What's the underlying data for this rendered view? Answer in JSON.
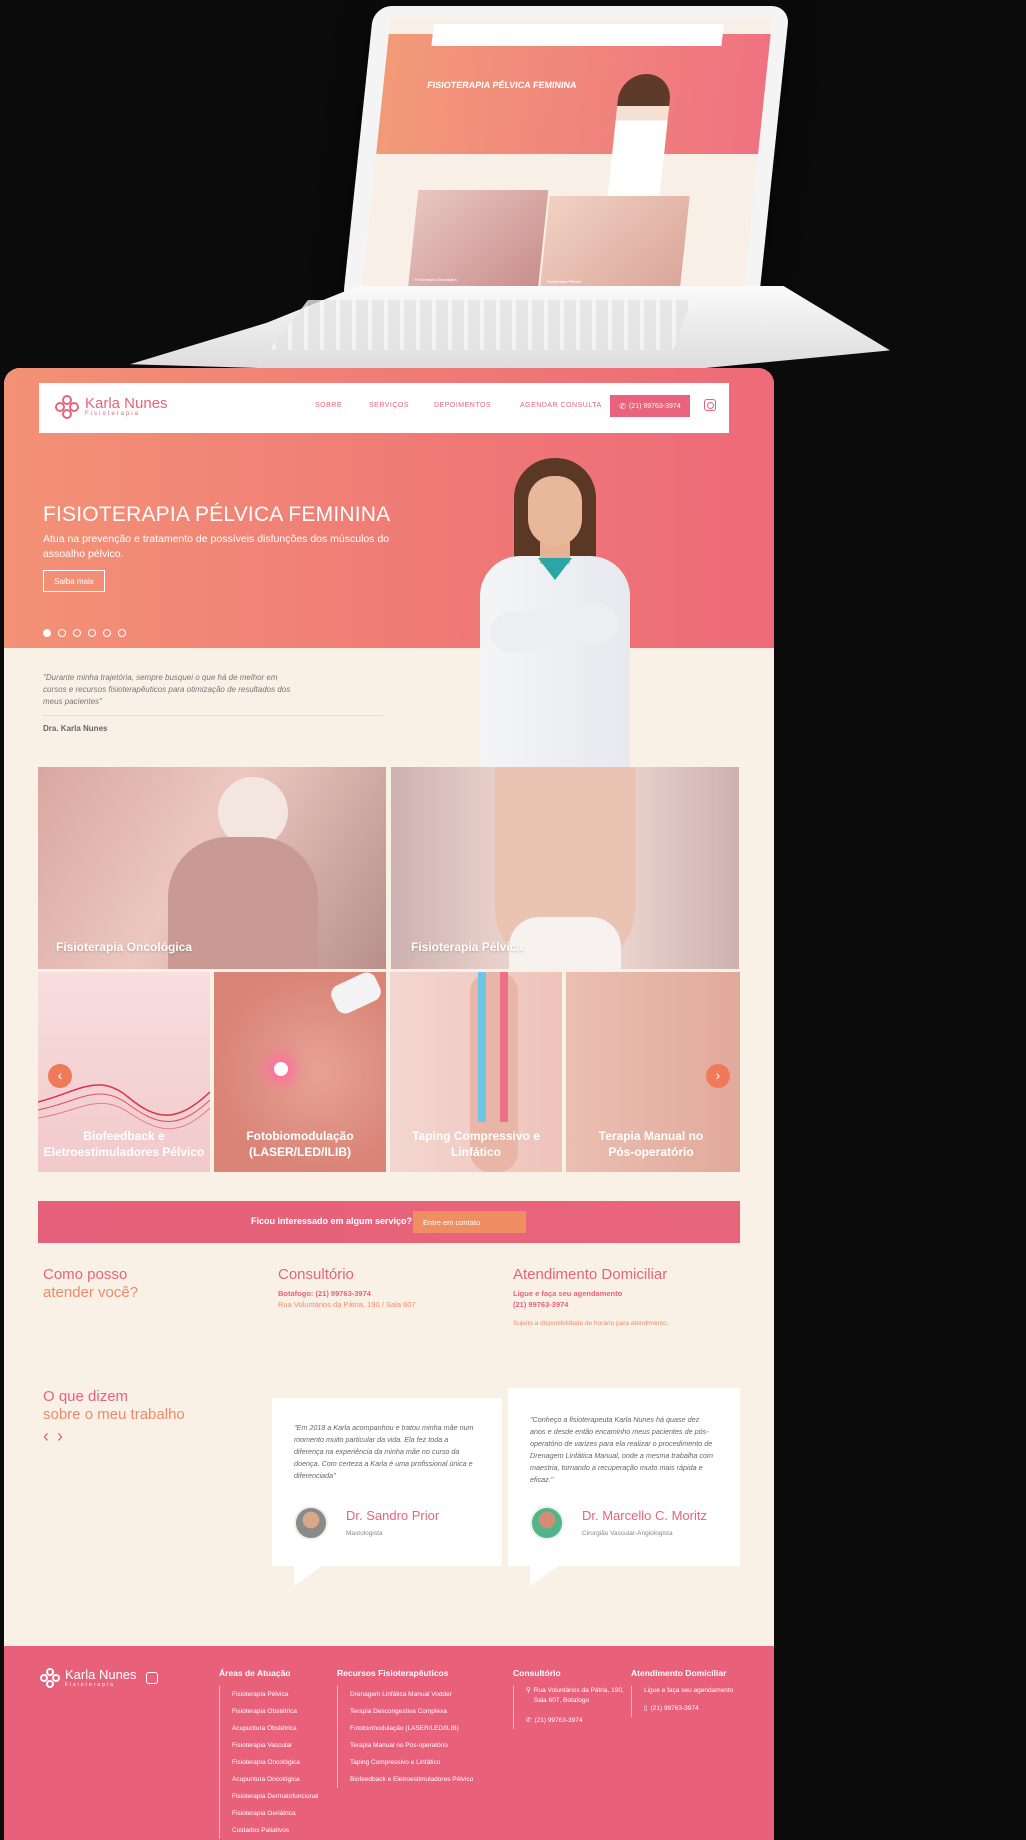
{
  "brand": {
    "name": "Karla Nunes",
    "tagline": "Fisioterapia"
  },
  "nav": {
    "items": [
      "SOBRE",
      "SERVIÇOS",
      "DEPOIMENTOS",
      "AGENDAR CONSULTA"
    ],
    "phone": "(21) 99763-3974"
  },
  "hero": {
    "title": "FISIOTERAPIA PÉLVICA FEMININA",
    "description": "Atua na prevenção e tratamento de possíveis disfunções dos músculos do assoalho pélvico.",
    "button": "Saiba mais",
    "slides": 6,
    "active_slide": 1
  },
  "quote": {
    "text": "\"Durante minha trajetória, sempre busquei o que há de melhor em cursos e recursos fisioterapêuticos para otimização de resultados dos meus pacientes\"",
    "author": "Dra. Karla Nunes"
  },
  "services": {
    "featured": [
      "Fisioterapia Oncológica",
      "Fisioterapia Pélvica"
    ],
    "carousel": [
      "Biofeedback e Eletroestimuladores Pélvico",
      "Fotobiomodulação (LASER/LED/ILIB)",
      "Taping Compressivo e Linfático",
      "Terapia Manual no Pós-operatório"
    ],
    "prev": "‹",
    "next": "›"
  },
  "cta": {
    "text": "Ficou interessado em algum serviço?",
    "button": "Entre em contato"
  },
  "info": {
    "help_title_1": "Como posso",
    "help_title_2": "atender você?",
    "office_title": "Consultório",
    "office_phone": "Botafogo: (21) 99763-3974",
    "office_address": "Rua Voluntários da Pátria, 190 / Sala 607",
    "home_title": "Atendimento Domiciliar",
    "home_line1": "Ligue e faça seu agendamento",
    "home_phone": "(21) 99763-3974",
    "home_note": "Sujeito a disponibilidade de horário para atendimento."
  },
  "testimonials": {
    "title_1": "O que dizem",
    "title_2": "sobre o meu trabalho",
    "prev": "‹",
    "next": "›",
    "items": [
      {
        "text": "\"Em 2018 a Karla acompanhou e tratou minha mãe num momento muito particular da vida. Ela fez toda a diferença na experiência da minha mãe no curso da doença. Com certeza a Karla é uma profissional única e diferenciada\"",
        "name": "Dr. Sandro Prior",
        "role": "Mastologista"
      },
      {
        "text": "\"Conheço a fisioterapeuta Karla Nunes há quase dez anos e desde então encaminho meus pacientes de pós-operatório de varizes para ela realizar o procedimento de Drenagem Linfática Manual, onde a mesma trabalha com maestria, tornando a recuperação muito mais rápida e eficaz.\"",
        "name": "Dr. Marcello C. Moritz",
        "role": "Cirurgião Vascular-Angiologista"
      }
    ]
  },
  "footer": {
    "areas_title": "Áreas de Atuação",
    "areas": [
      "Fisioterapia Pélvica",
      "Fisioterapia Obstétrica",
      "Acupuntura Obstétrica",
      "Fisioterapia Vascular",
      "Fisioterapia Oncológica",
      "Acupuntura Oncológica",
      "Fisioterapia Dermatofuncional",
      "Fisioterapia Geriátrica",
      "Cuidados Paliativos"
    ],
    "resources_title": "Recursos Fisioterapêuticos",
    "resources": [
      "Drenagem Linfática Manual Vodder",
      "Terapia Descongestiva Complexa",
      "Fotobiomodulação (LASER/LED/ILIB)",
      "Terapia Manual no Pós-operatório",
      "Taping Compressivo e Linfático",
      "Biofeedback e Eletroestimuladores Pélvico"
    ],
    "office_title": "Consultório",
    "office_address": "Rua Voluntários da Pátria, 190, Sala 607, Botafogo",
    "office_phone": "(21) 99763-3974",
    "home_title": "Atendimento Domiciliar",
    "home_line": "Ligue e faça seu agendamento",
    "home_phone": "(21) 99763-3974"
  },
  "mockup": {
    "title": "FISIOTERAPIA PÉLVICA FEMININA",
    "card1": "Fisioterapia Oncológica",
    "card2": "Fisioterapia Pélvica"
  },
  "colors": {
    "accent": "#e8637b",
    "peach": "#ef8e63",
    "cream": "#f9f1e6"
  }
}
